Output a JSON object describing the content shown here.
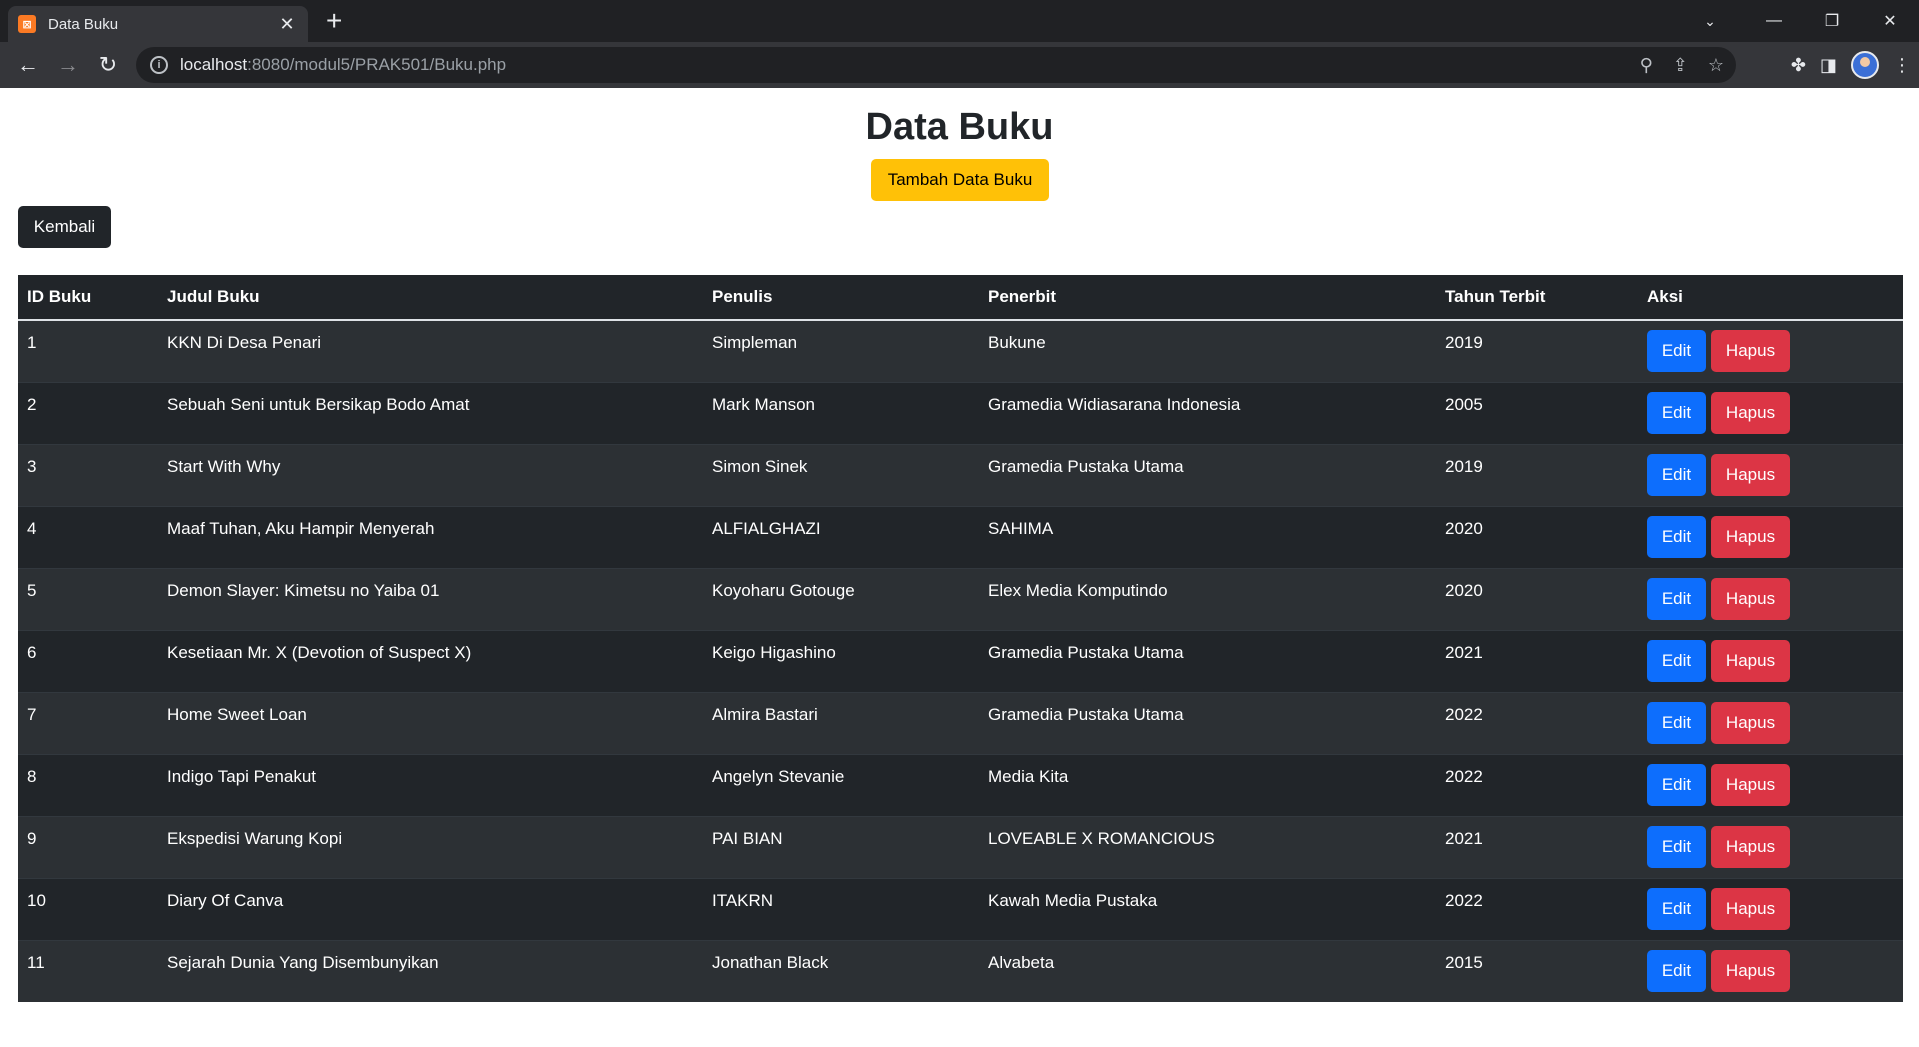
{
  "browser": {
    "tab_title": "Data Buku",
    "tab_favicon": "⊠",
    "url_host": "localhost",
    "url_rest": ":8080/modul5/PRAK501/Buku.php"
  },
  "page": {
    "title": "Data Buku",
    "add_button": "Tambah Data Buku",
    "back_button": "Kembali"
  },
  "table": {
    "headers": [
      "ID Buku",
      "Judul Buku",
      "Penulis",
      "Penerbit",
      "Tahun Terbit",
      "Aksi"
    ],
    "edit_label": "Edit",
    "delete_label": "Hapus",
    "rows": [
      {
        "id": "1",
        "judul": "KKN Di Desa Penari",
        "penulis": "Simpleman",
        "penerbit": "Bukune",
        "tahun": "2019"
      },
      {
        "id": "2",
        "judul": "Sebuah Seni untuk Bersikap Bodo Amat",
        "penulis": "Mark Manson",
        "penerbit": "Gramedia Widiasarana Indonesia",
        "tahun": "2005"
      },
      {
        "id": "3",
        "judul": "Start With Why",
        "penulis": "Simon Sinek",
        "penerbit": "Gramedia Pustaka Utama",
        "tahun": "2019"
      },
      {
        "id": "4",
        "judul": "Maaf Tuhan, Aku Hampir Menyerah",
        "penulis": "ALFIALGHAZI",
        "penerbit": "SAHIMA",
        "tahun": "2020"
      },
      {
        "id": "5",
        "judul": "Demon Slayer: Kimetsu no Yaiba 01",
        "penulis": "Koyoharu Gotouge",
        "penerbit": "Elex Media Komputindo",
        "tahun": "2020"
      },
      {
        "id": "6",
        "judul": "Kesetiaan Mr. X (Devotion of Suspect X)",
        "penulis": "Keigo Higashino",
        "penerbit": "Gramedia Pustaka Utama",
        "tahun": "2021"
      },
      {
        "id": "7",
        "judul": "Home Sweet Loan",
        "penulis": "Almira Bastari",
        "penerbit": "Gramedia Pustaka Utama",
        "tahun": "2022"
      },
      {
        "id": "8",
        "judul": "Indigo Tapi Penakut",
        "penulis": "Angelyn Stevanie",
        "penerbit": "Media Kita",
        "tahun": "2022"
      },
      {
        "id": "9",
        "judul": "Ekspedisi Warung Kopi",
        "penulis": "PAI BIAN",
        "penerbit": "LOVEABLE X ROMANCIOUS",
        "tahun": "2021"
      },
      {
        "id": "10",
        "judul": "Diary Of Canva",
        "penulis": "ITAKRN",
        "penerbit": "Kawah Media Pustaka",
        "tahun": "2022"
      },
      {
        "id": "11",
        "judul": "Sejarah Dunia Yang Disembunyikan",
        "penulis": "Jonathan Black",
        "penerbit": "Alvabeta",
        "tahun": "2015"
      }
    ]
  },
  "colors": {
    "accent_add": "#ffc107",
    "edit": "#0d6efd",
    "delete": "#dc3545",
    "table_bg": "#212529"
  }
}
